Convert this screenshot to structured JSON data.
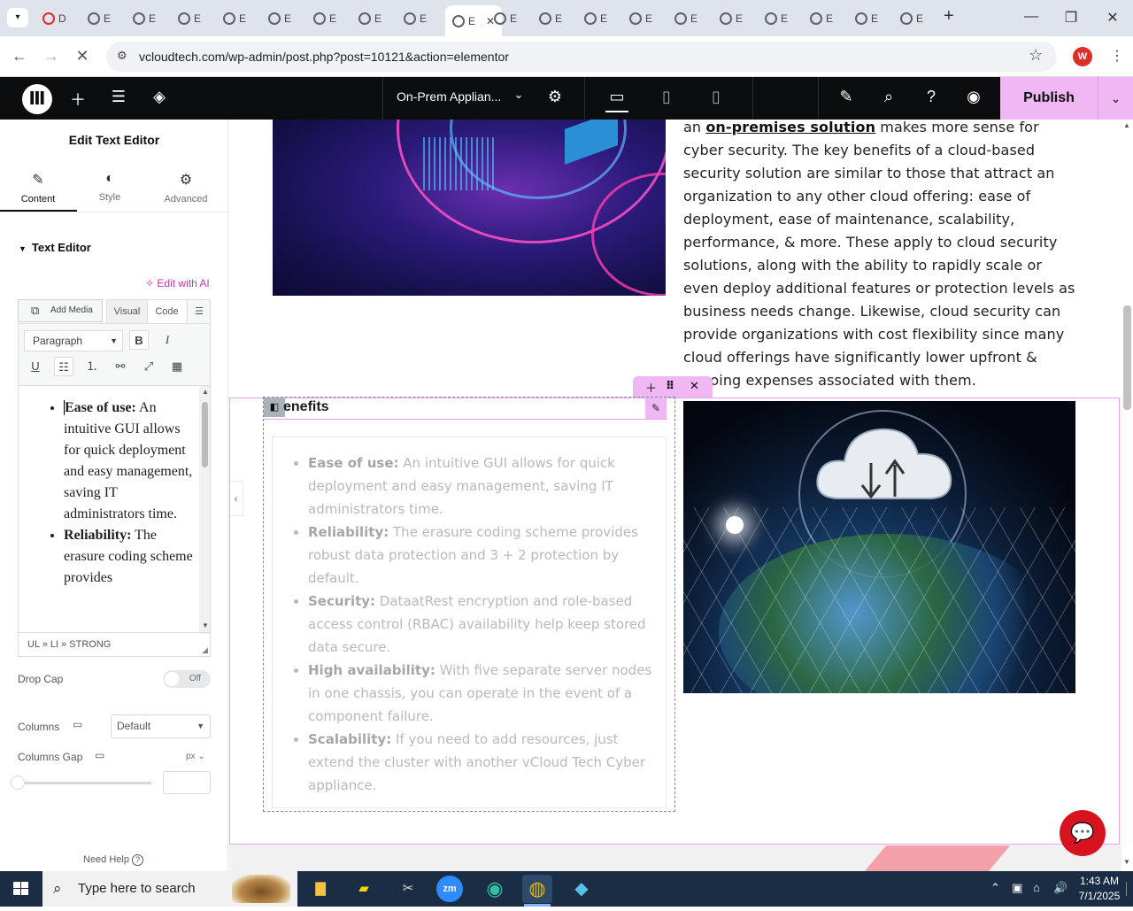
{
  "browser": {
    "tabs": [
      {
        "label": "D",
        "icon": "pdf-icon"
      },
      {
        "label": "E"
      },
      {
        "label": "E"
      },
      {
        "label": "E"
      },
      {
        "label": "E"
      },
      {
        "label": "E"
      },
      {
        "label": "E"
      },
      {
        "label": "E"
      },
      {
        "label": "E"
      },
      {
        "label": "E",
        "active": true
      },
      {
        "label": "E"
      },
      {
        "label": "E"
      },
      {
        "label": "E"
      },
      {
        "label": "E"
      },
      {
        "label": "E"
      },
      {
        "label": "E"
      },
      {
        "label": "E"
      },
      {
        "label": "E"
      },
      {
        "label": "E"
      },
      {
        "label": "E"
      }
    ],
    "close_tab": "✕",
    "new_tab": "+",
    "url": "vcloudtech.com/wp-admin/post.php?post=10121&action=elementor",
    "profile_initial": "W"
  },
  "topbar": {
    "page_name": "On-Prem Applian...",
    "publish_label": "Publish"
  },
  "panel": {
    "title": "Edit Text Editor",
    "tabs": [
      {
        "label": "Content",
        "icon": "pencil-icon"
      },
      {
        "label": "Style",
        "icon": "half-circle-icon"
      },
      {
        "label": "Advanced",
        "icon": "gear-icon"
      }
    ],
    "section_title": "Text Editor",
    "edit_with_ai": "Edit with AI",
    "add_media": "Add Media",
    "visual_tab": "Visual",
    "code_tab": "Code",
    "format_select": "Paragraph",
    "editor_items": [
      {
        "strong": "Ease of use:",
        "text": " An intuitive GUI allows for quick deployment and easy management, saving IT administrators time."
      },
      {
        "strong": "Reliability:",
        "text": " The erasure coding scheme provides"
      }
    ],
    "path": "UL » LI » STRONG",
    "drop_cap_label": "Drop Cap",
    "drop_cap_state": "Off",
    "columns_label": "Columns",
    "columns_value": "Default",
    "columns_gap_label": "Columns Gap",
    "columns_gap_unit": "px",
    "need_help": "Need Help"
  },
  "canvas": {
    "intro_before": "an ",
    "intro_link": "on-premises solution",
    "intro_after": " makes more sense for cyber security. The key benefits of a cloud-based security solution are similar to those that attract an organization to any other cloud offering: ease of deployment, ease of maintenance, scalability, performance, & more. These apply to cloud security solutions, along with the ability to rapidly scale or even deploy additional features or protection levels as business needs change. Likewise, cloud security can provide organizations with cost flexibility since many cloud offerings have significantly lower upfront & ongoing expenses associated with them.",
    "heading": "enefits",
    "benefits": [
      {
        "strong": "Ease of use:",
        "text": " An intuitive GUI allows for quick deployment and easy management, saving IT administrators time."
      },
      {
        "strong": "Reliability:",
        "text": " The erasure coding scheme provides robust data protection and 3 + 2 protection by default."
      },
      {
        "strong": "Security:",
        "text": " DataatRest encryption and role-based access control (RBAC) availability help keep stored data secure."
      },
      {
        "strong": "High availability:",
        "text": " With five separate server nodes in one chassis, you can operate in the event of a component failure."
      },
      {
        "strong": "Scalability:",
        "text": " If you need to add resources, just extend the cluster with another vCloud Tech Cyber appliance."
      }
    ]
  },
  "taskbar": {
    "search_placeholder": "Type here to search",
    "time": "1:43 AM",
    "date": "7/1/2025"
  },
  "colors": {
    "accent_pink": "#f0b7f3",
    "elementor_black": "#0c0d0e",
    "ai_magenta": "#c036b7",
    "chat_red": "#d7131f"
  }
}
